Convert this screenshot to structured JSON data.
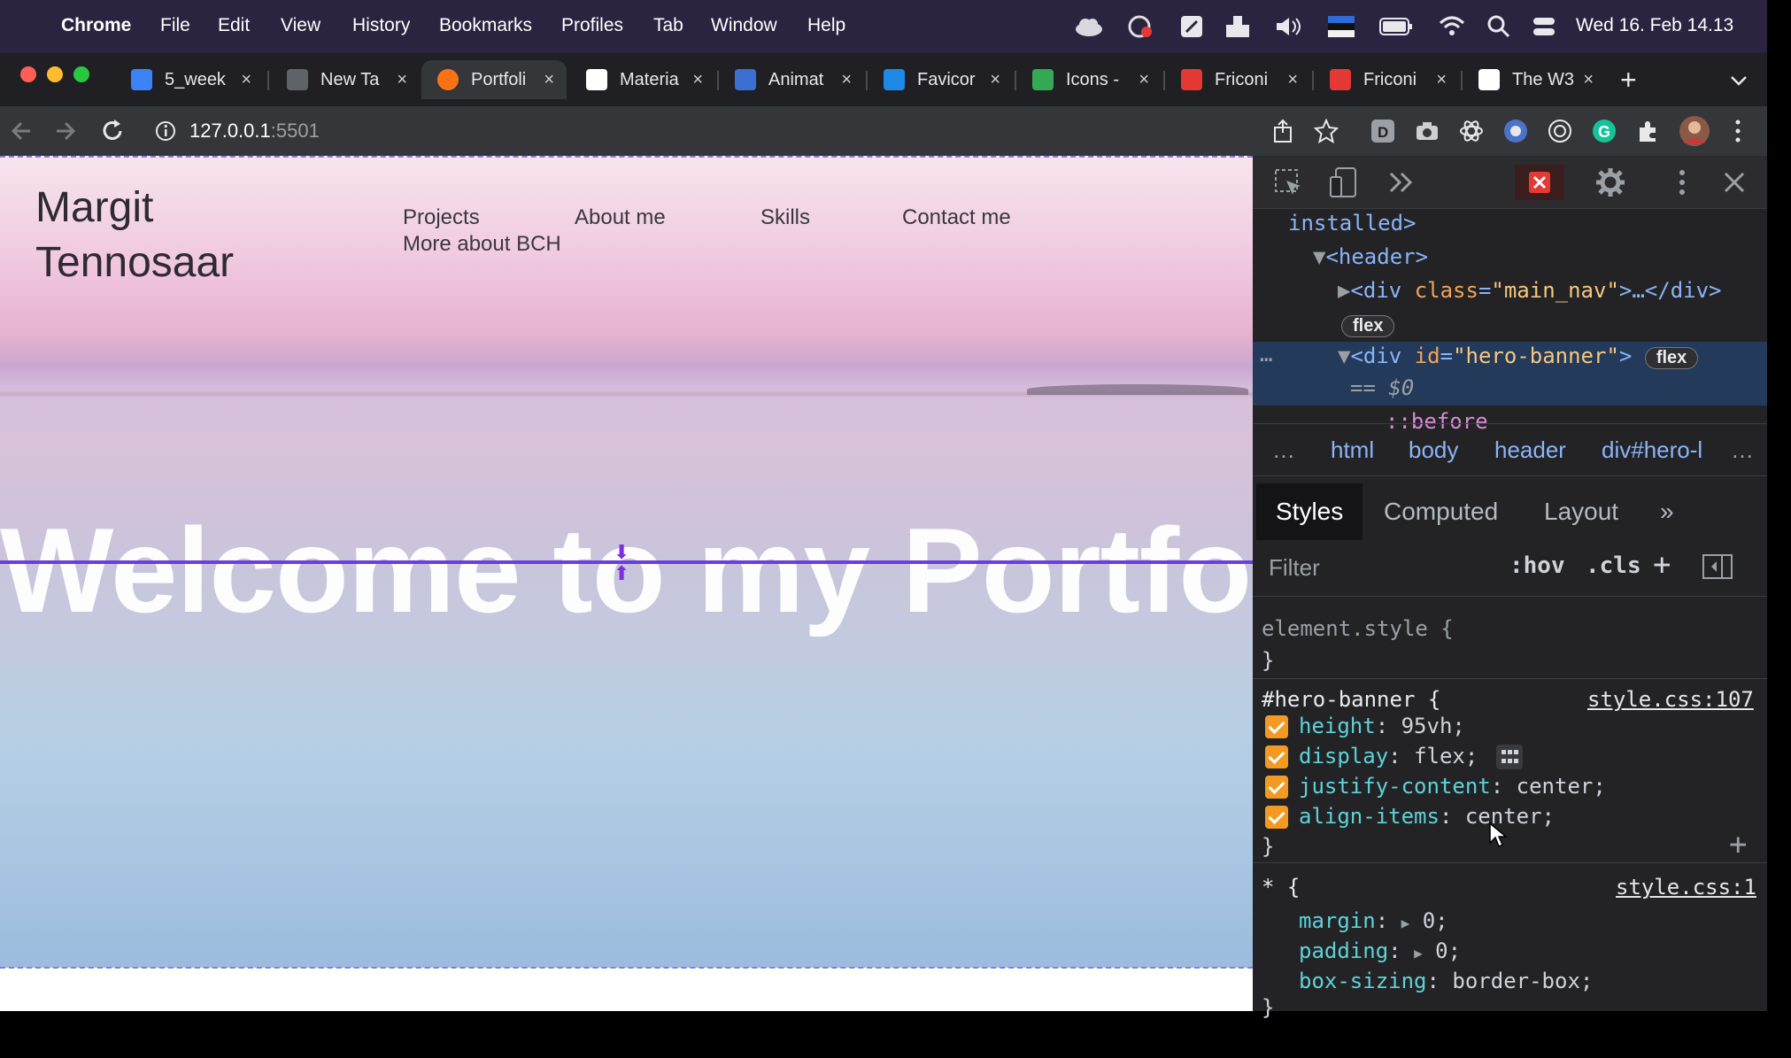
{
  "menubar": {
    "apple": "",
    "app": "Chrome",
    "items": [
      "File",
      "Edit",
      "View",
      "History",
      "Bookmarks",
      "Profiles",
      "Tab",
      "Window",
      "Help"
    ],
    "clock": "Wed 16. Feb 14.13"
  },
  "tabs": [
    {
      "title": "5_week",
      "favicon": "#3b82f6"
    },
    {
      "title": "New Ta",
      "favicon": "#5f6368"
    },
    {
      "title": "Portfoli",
      "favicon": "#f97316",
      "active": true
    },
    {
      "title": "Materia",
      "favicon": "#ffffff"
    },
    {
      "title": "Animat",
      "favicon": "#3b6fd1"
    },
    {
      "title": "Favicor",
      "favicon": "#1e88e5"
    },
    {
      "title": "Icons -",
      "favicon": "#34a853"
    },
    {
      "title": "Friconi",
      "favicon": "#e53935"
    },
    {
      "title": "Friconi",
      "favicon": "#e53935"
    },
    {
      "title": "The W3",
      "favicon": "#ffffff"
    }
  ],
  "tab_close": "×",
  "new_tab": "+",
  "toolbar": {
    "url_host": "127.0.0.1",
    "url_port": ":5501"
  },
  "site": {
    "logo_line1": "Margit",
    "logo_line2": "Tennosaar",
    "nav": [
      "Projects",
      "About me",
      "Skills",
      "Contact me",
      "More about BCH"
    ],
    "hero_title": "Welcome to my Portfolio"
  },
  "devtools": {
    "dom_lines": {
      "installed": "installed>",
      "header_open": "<header>",
      "main_nav_tag": "<div ",
      "main_nav_attr": "class",
      "main_nav_val": "\"main_nav\"",
      "main_nav_end": ">…</div>",
      "flex1": "flex",
      "hero_tag": "<div ",
      "hero_attr": "id",
      "hero_val": "\"hero-banner\"",
      "hero_end": ">",
      "flex2": "flex",
      "dollar0": "== $0",
      "before": "::before"
    },
    "breadcrumbs": [
      "html",
      "body",
      "header",
      "div#hero-l"
    ],
    "tabs": [
      "Styles",
      "Computed",
      "Layout"
    ],
    "filter_placeholder": "Filter",
    "hov": ":hov",
    "cls": ".cls",
    "rules": {
      "element_style": "element.style {",
      "close": "}",
      "hero_selector": "#hero-banner {",
      "hero_source": "style.css:107",
      "hero_props": [
        {
          "name": "height",
          "value": "95vh;"
        },
        {
          "name": "display",
          "value": "flex;"
        },
        {
          "name": "justify-content",
          "value": "center;"
        },
        {
          "name": "align-items",
          "value": "center;"
        }
      ],
      "star_selector": "* {",
      "star_source": "style.css:1",
      "star_props": [
        {
          "name": "margin",
          "value": "0;"
        },
        {
          "name": "padding",
          "value": "0;"
        },
        {
          "name": "box-sizing",
          "value": "border-box;"
        }
      ]
    }
  }
}
